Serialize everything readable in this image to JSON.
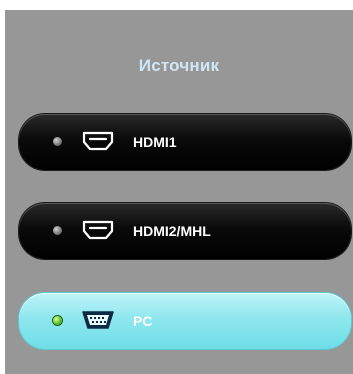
{
  "menu": {
    "title": "Источник",
    "sources": [
      {
        "label": "HDMI1",
        "icon": "hdmi-port-icon",
        "selected": false
      },
      {
        "label": "HDMI2/MHL",
        "icon": "hdmi-port-icon",
        "selected": false
      },
      {
        "label": "PC",
        "icon": "vga-port-icon",
        "selected": true
      }
    ]
  },
  "colors": {
    "panel": "#979797",
    "title": "#cfe6f5",
    "button_dark": "#000000",
    "button_selected": "#8ee7ee",
    "led_active": "#3fae1c"
  }
}
